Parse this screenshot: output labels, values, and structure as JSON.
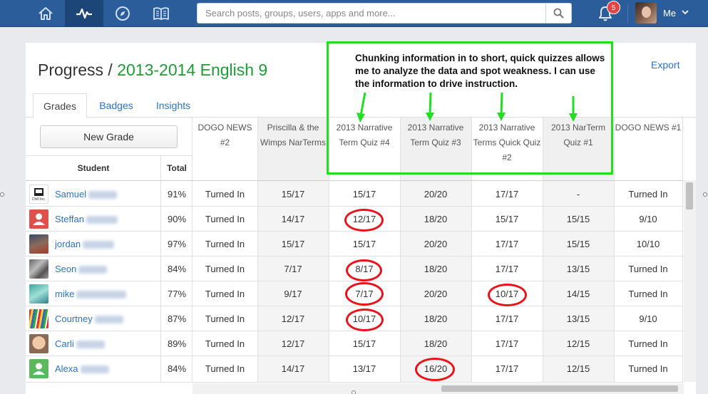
{
  "nav": {
    "search_placeholder": "Search posts, groups, users, apps and more...",
    "notification_count": "5",
    "me_label": "Me",
    "icons": [
      "home-icon",
      "activity-icon",
      "compass-icon",
      "book-icon",
      "search-icon",
      "bell-icon",
      "chevron-down-icon"
    ]
  },
  "page": {
    "title_prefix": "Progress / ",
    "course": "2013-2014 English 9",
    "export_label": "Export"
  },
  "tabs": [
    {
      "label": "Grades",
      "active": true
    },
    {
      "label": "Badges",
      "active": false
    },
    {
      "label": "Insights",
      "active": false
    }
  ],
  "new_grade_label": "New Grade",
  "columns": {
    "student": "Student",
    "total": "Total"
  },
  "assignments": [
    "DOGO NEWS #2",
    "Priscilla & the Wimps NarTerms",
    "2013 Narrative Term Quiz #4",
    "2013 Narrative Term Quiz #3",
    "2013 Narrative Terms Quick Quiz #2",
    "2013 NarTerm Quiz #1",
    "DOGO NEWS #1"
  ],
  "students": [
    {
      "name": "Samuel",
      "total": "91%",
      "grades": [
        "Turned In",
        "15/17",
        "15/17",
        "20/20",
        "17/17",
        "-",
        "Turned In"
      ]
    },
    {
      "name": "Steffan",
      "total": "90%",
      "grades": [
        "Turned In",
        "14/17",
        "12/17",
        "18/20",
        "15/17",
        "15/15",
        "9/10"
      ]
    },
    {
      "name": "jordan",
      "total": "97%",
      "grades": [
        "Turned In",
        "15/17",
        "15/17",
        "20/20",
        "17/17",
        "15/15",
        "10/10"
      ]
    },
    {
      "name": "Seon",
      "total": "84%",
      "grades": [
        "Turned In",
        "7/17",
        "8/17",
        "18/20",
        "17/17",
        "13/15",
        "Turned In"
      ]
    },
    {
      "name": "mike",
      "total": "77%",
      "grades": [
        "Turned In",
        "9/17",
        "7/17",
        "20/20",
        "10/17",
        "14/15",
        "Turned In"
      ]
    },
    {
      "name": "Courtney",
      "total": "87%",
      "grades": [
        "Turned In",
        "12/17",
        "10/17",
        "18/20",
        "17/17",
        "13/15",
        "9/10"
      ]
    },
    {
      "name": "Carli",
      "total": "89%",
      "grades": [
        "Turned In",
        "12/17",
        "15/17",
        "18/20",
        "17/17",
        "12/15",
        "Turned In"
      ]
    },
    {
      "name": "Alexa",
      "total": "84%",
      "grades": [
        "Turned In",
        "14/17",
        "13/17",
        "16/20",
        "17/17",
        "12/15",
        "Turned In"
      ]
    }
  ],
  "annotation": {
    "text": "Chunking information in to short, quick quizzes allows me to analyze the data and spot weakness. I can use the information to drive instruction.",
    "color": "#22dd22",
    "circle_color": "#e8141b"
  }
}
